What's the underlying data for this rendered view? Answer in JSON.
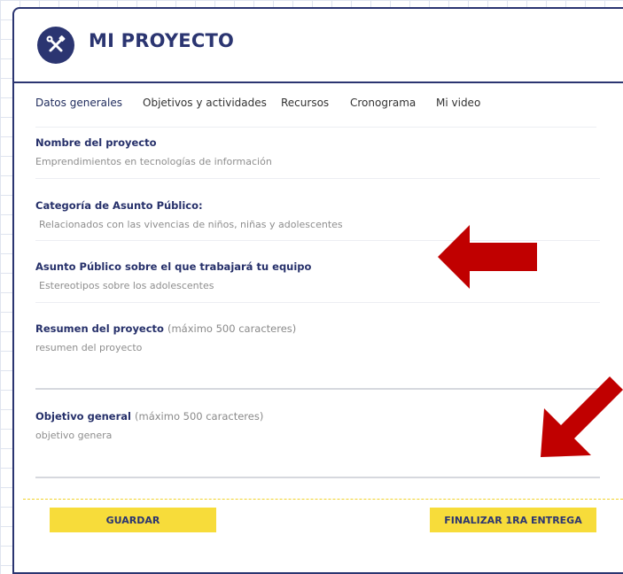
{
  "header": {
    "title": "MI PROYECTO",
    "icon": "tools-icon"
  },
  "tabs": [
    {
      "label": "Datos generales",
      "active": true
    },
    {
      "label": "Objetivos y actividades"
    },
    {
      "label": "Recursos"
    },
    {
      "label": "Cronograma"
    },
    {
      "label": "Mi video"
    }
  ],
  "fields": {
    "nombre": {
      "label": "Nombre del proyecto",
      "value": "Emprendimientos en tecnologías de información"
    },
    "categoria": {
      "label": "Categoría de Asunto Público:",
      "value": "Relacionados con las vivencias de niños, niñas y adolescentes"
    },
    "asunto": {
      "label": "Asunto Público sobre el que trabajará tu equipo",
      "value": "Estereotipos sobre los adolescentes"
    },
    "resumen": {
      "label": "Resumen del proyecto",
      "hint": "(máximo 500 caracteres)",
      "value": "resumen del proyecto"
    },
    "objetivo": {
      "label": "Objetivo general",
      "hint": "(máximo 500 caracteres)",
      "value": "objetivo genera"
    }
  },
  "buttons": {
    "save": "GUARDAR",
    "finish": "FINALIZAR 1RA ENTREGA"
  },
  "colors": {
    "brand": "#2b3571",
    "accent": "#f7dc3a",
    "annotation_arrow": "#c00000"
  }
}
